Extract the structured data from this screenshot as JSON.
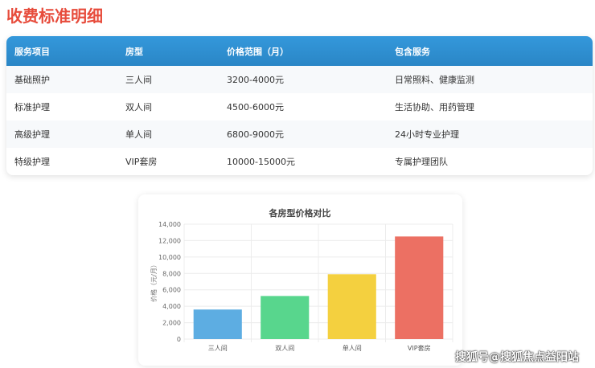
{
  "title": "收费标准明细",
  "table": {
    "headers": [
      "服务项目",
      "房型",
      "价格范围（月）",
      "包含服务"
    ],
    "rows": [
      [
        "基础照护",
        "三人间",
        "3200-4000元",
        "日常照料、健康监测"
      ],
      [
        "标准护理",
        "双人间",
        "4500-6000元",
        "生活协助、用药管理"
      ],
      [
        "高级护理",
        "单人间",
        "6800-9000元",
        "24小时专业护理"
      ],
      [
        "特级护理",
        "VIP套房",
        "10000-15000元",
        "专属护理团队"
      ]
    ]
  },
  "chart_data": {
    "type": "bar",
    "title": "各房型价格对比",
    "xlabel": "",
    "ylabel": "价格（元/月）",
    "categories": [
      "三人间",
      "双人间",
      "单人间",
      "VIP套房"
    ],
    "values": [
      3600,
      5250,
      7900,
      12500
    ],
    "colors": [
      "#5dade2",
      "#58d68d",
      "#f4d03f",
      "#ec7063"
    ],
    "ylim": [
      0,
      14000
    ],
    "yticks": [
      0,
      2000,
      4000,
      6000,
      8000,
      10000,
      12000,
      14000
    ],
    "grid": true
  },
  "watermark": "搜狐号@搜狐焦点益阳站"
}
